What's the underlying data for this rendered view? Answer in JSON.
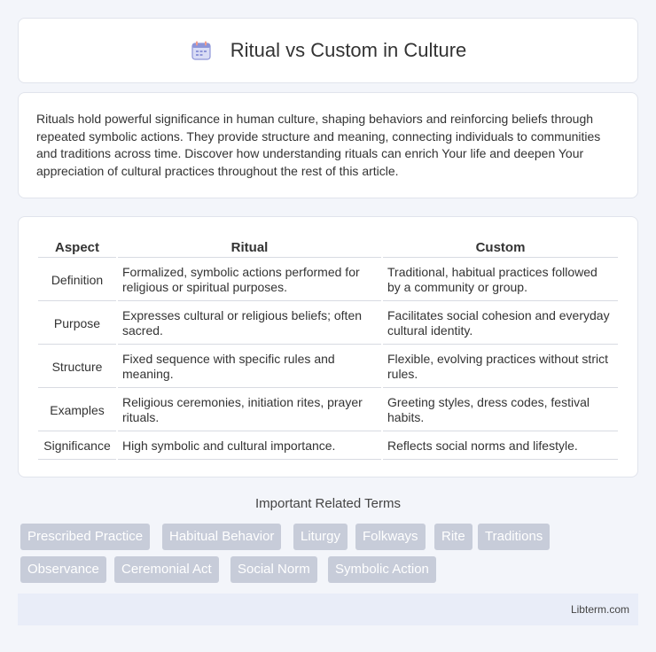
{
  "header": {
    "title": "Ritual vs Custom in Culture",
    "icon": "calendar-icon"
  },
  "intro": {
    "text": "Rituals hold powerful significance in human culture, shaping behaviors and reinforcing beliefs through repeated symbolic actions. They provide structure and meaning, connecting individuals to communities and traditions across time. Discover how understanding rituals can enrich Your life and deepen Your appreciation of cultural practices throughout the rest of this article."
  },
  "table": {
    "headers": [
      "Aspect",
      "Ritual",
      "Custom"
    ],
    "rows": [
      [
        "Definition",
        "Formalized, symbolic actions performed for religious or spiritual purposes.",
        "Traditional, habitual practices followed by a community or group."
      ],
      [
        "Purpose",
        "Expresses cultural or religious beliefs; often sacred.",
        "Facilitates social cohesion and everyday cultural identity."
      ],
      [
        "Structure",
        "Fixed sequence with specific rules and meaning.",
        "Flexible, evolving practices without strict rules."
      ],
      [
        "Examples",
        "Religious ceremonies, initiation rites, prayer rituals.",
        "Greeting styles, dress codes, festival habits."
      ],
      [
        "Significance",
        "High symbolic and cultural importance.",
        "Reflects social norms and lifestyle."
      ]
    ]
  },
  "related": {
    "title": "Important Related Terms",
    "tags": [
      "Prescribed Practice",
      "Habitual Behavior",
      "Liturgy",
      "Folkways",
      "Rite",
      "Traditions",
      "Observance",
      "Ceremonial Act",
      "Social Norm",
      "Symbolic Action"
    ]
  },
  "footer": {
    "text": "Libterm.com"
  },
  "colors": {
    "tag_bg": "#c7ccd9",
    "footer_bg": "#e9edf8",
    "page_bg": "#f3f5fa"
  }
}
